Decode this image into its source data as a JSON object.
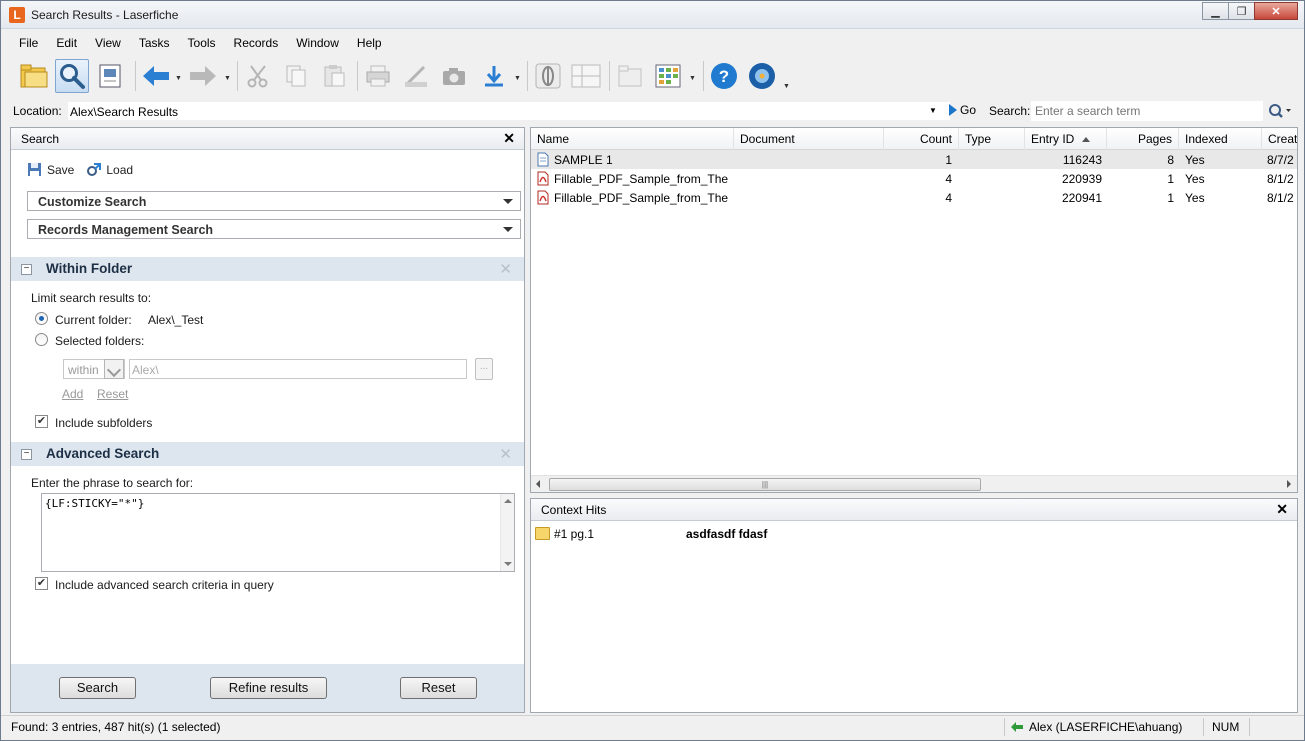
{
  "window": {
    "title": "Search Results - Laserfiche",
    "app_icon_letter": "L"
  },
  "menu": [
    "File",
    "Edit",
    "View",
    "Tasks",
    "Tools",
    "Records",
    "Window",
    "Help"
  ],
  "location": {
    "label": "Location:",
    "value": "Alex\\Search Results"
  },
  "quick_search": {
    "go_label": "Go",
    "label": "Search:",
    "placeholder": "Enter a search term"
  },
  "search_pane": {
    "title": "Search",
    "save_label": "Save",
    "load_label": "Load",
    "customize_label": "Customize Search",
    "records_label": "Records Management Search",
    "within_folder": {
      "title": "Within Folder",
      "limit_label": "Limit search results to:",
      "current_folder_label": "Current folder:",
      "current_folder_value": "Alex\\_Test",
      "selected_folders_label": "Selected folders:",
      "scope_value": "within",
      "path_value": "Alex\\",
      "browse_label": "...",
      "add_label": "Add",
      "reset_label": "Reset",
      "include_subfolders_label": "Include subfolders",
      "include_subfolders_checked": true
    },
    "advanced": {
      "title": "Advanced Search",
      "phrase_label": "Enter the phrase to search for:",
      "phrase_value": "{LF:STICKY=\"*\"}",
      "include_criteria_label": "Include advanced search criteria in query",
      "include_criteria_checked": true
    },
    "buttons": {
      "search": "Search",
      "refine": "Refine results",
      "reset": "Reset"
    }
  },
  "results": {
    "columns": [
      "Name",
      "Document",
      "Count",
      "Type",
      "Entry ID",
      "Pages",
      "Indexed",
      "Creat"
    ],
    "rows": [
      {
        "name": "SAMPLE 1",
        "document": "",
        "count": "1",
        "type": "",
        "entry_id": "116243",
        "pages": "8",
        "indexed": "Yes",
        "created": "8/7/2",
        "icon": "document-icon",
        "selected": true
      },
      {
        "name": "Fillable_PDF_Sample_from_The...",
        "document": "",
        "count": "4",
        "type": "",
        "entry_id": "220939",
        "pages": "1",
        "indexed": "Yes",
        "created": "8/1/2",
        "icon": "pdf-icon",
        "selected": false
      },
      {
        "name": "Fillable_PDF_Sample_from_The...",
        "document": "",
        "count": "4",
        "type": "",
        "entry_id": "220941",
        "pages": "1",
        "indexed": "Yes",
        "created": "8/1/2",
        "icon": "pdf-icon",
        "selected": false
      }
    ]
  },
  "context_hits": {
    "title": "Context Hits",
    "hits": [
      {
        "ref": "#1 pg.1",
        "text": "asdfasdf fdasf"
      }
    ]
  },
  "status": {
    "found": "Found: 3 entries, 487 hit(s) (1 selected)",
    "user": "Alex (LASERFICHE\\ahuang)",
    "num": "NUM"
  }
}
